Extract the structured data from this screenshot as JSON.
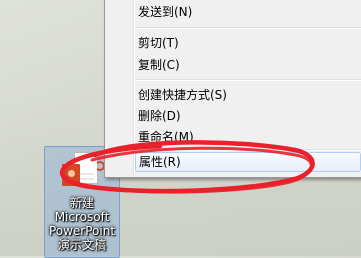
{
  "context_menu": {
    "items": [
      {
        "label": "发送到(N)"
      },
      {
        "label": "剪切(T)"
      },
      {
        "label": "复制(C)"
      },
      {
        "label": "创建快捷方式(S)"
      },
      {
        "label": "删除(D)"
      },
      {
        "label": "重命名(M)"
      },
      {
        "label": "属性(R)"
      }
    ]
  },
  "desktop_icon": {
    "label_lines": [
      "新建",
      "Microsoft",
      "PowerPoint",
      "演示文稿"
    ],
    "icon": "powerpoint-file-icon"
  },
  "annotation": {
    "color": "#e8212a",
    "shape": "ellipse"
  },
  "colors": {
    "menu_bg": "#f0f0f0",
    "highlight_border": "#aecff7",
    "ppt_brand": "#d24726"
  }
}
